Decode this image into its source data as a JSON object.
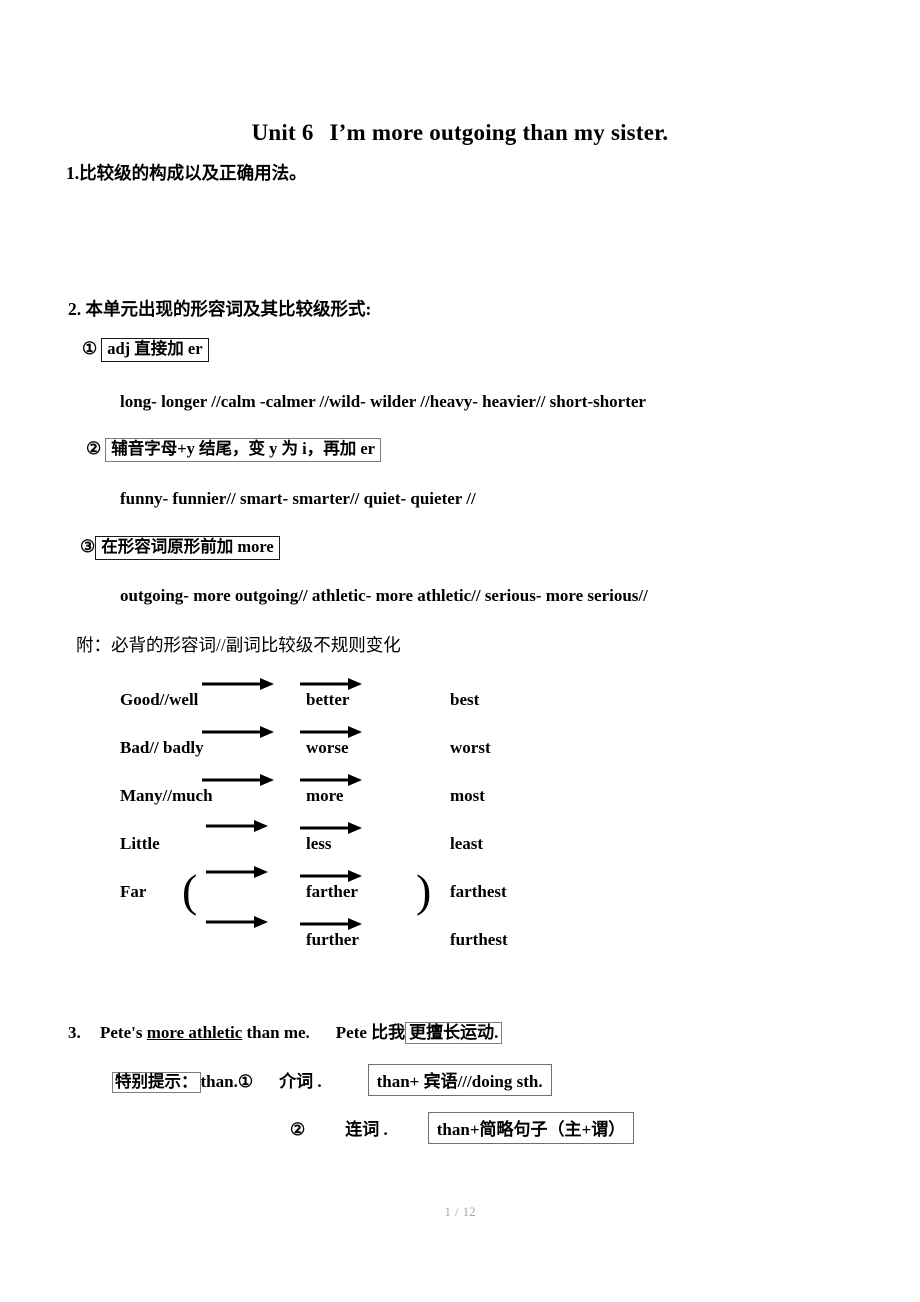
{
  "title": {
    "unit": "Unit 6",
    "sentence": "I’m more outgoing than my sister."
  },
  "sections": {
    "item1": "1.比较级的构成以及正确用法。",
    "item2": "2. 本单元出现的形容词及其比较级形式:",
    "irregular_note": "附：必背的形容词//副词比较级不规则变化"
  },
  "rules": [
    {
      "marker": "①",
      "label": "adj 直接加 er",
      "examples": "long- longer    //calm -calmer    //wild- wilder    //heavy- heavier// short-shorter"
    },
    {
      "marker": "②",
      "label": "辅音字母+y 结尾，变 y 为 i，再加 er",
      "examples": "funny- funnier//    smart- smarter//    quiet- quieter //"
    },
    {
      "marker": "③",
      "label": "在形容词原形前加 more",
      "examples": "outgoing- more outgoing//    athletic- more athletic//    serious- more serious//"
    }
  ],
  "irregular_table": {
    "rows": [
      {
        "base": "Good//well",
        "comparative": "better",
        "superlative": "best"
      },
      {
        "base": "Bad// badly",
        "comparative": "worse",
        "superlative": "worst"
      },
      {
        "base": "Many//much",
        "comparative": "more",
        "superlative": "most"
      },
      {
        "base": "Little",
        "comparative": "less",
        "superlative": "least"
      },
      {
        "base": "Far",
        "comparative": "farther",
        "superlative": "farthest"
      },
      {
        "base": "",
        "comparative": "further",
        "superlative": "furthest"
      }
    ],
    "bracket_left": "(",
    "bracket_right": ")"
  },
  "example": {
    "number": "3.",
    "english_before": "Pete's ",
    "english_underlined": "more athletic",
    "english_after": " than me.",
    "chinese_before": "Pete 比我",
    "chinese_boxed": "更擅长运动."
  },
  "tips": {
    "label": "特别提示：",
    "than": "than.",
    "item1_marker": "①",
    "item1_text": "介词 .",
    "item1_box": "than+  宾语///doing sth.",
    "item2_marker": "②",
    "item2_text": "连词 .",
    "item2_box": "than+简略句子（主+谓）"
  },
  "footer": {
    "current_page": "1",
    "separator": "/",
    "total_pages": "12"
  }
}
